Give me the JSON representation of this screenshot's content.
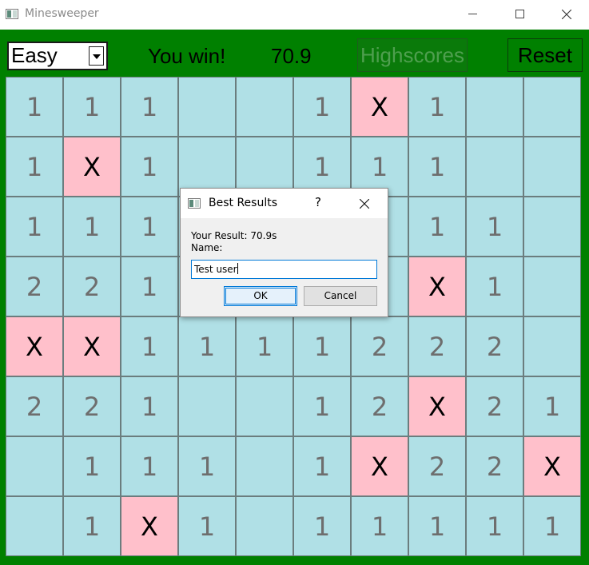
{
  "window": {
    "title": "Minesweeper"
  },
  "toolbar": {
    "difficulty": "Easy",
    "status": "You win!",
    "timer": "70.9",
    "highscores_label": "Highscores",
    "reset_label": "Reset"
  },
  "board": {
    "rows": [
      [
        {
          "t": "1"
        },
        {
          "t": "1"
        },
        {
          "t": "1"
        },
        {
          "t": ""
        },
        {
          "t": ""
        },
        {
          "t": "1"
        },
        {
          "t": "X",
          "mine": true
        },
        {
          "t": "1"
        },
        {
          "t": ""
        },
        {
          "t": ""
        }
      ],
      [
        {
          "t": "1"
        },
        {
          "t": "X",
          "mine": true
        },
        {
          "t": "1"
        },
        {
          "t": ""
        },
        {
          "t": ""
        },
        {
          "t": "1"
        },
        {
          "t": "1"
        },
        {
          "t": "1"
        },
        {
          "t": ""
        },
        {
          "t": ""
        }
      ],
      [
        {
          "t": "1"
        },
        {
          "t": "1"
        },
        {
          "t": "1"
        },
        {
          "t": ""
        },
        {
          "t": ""
        },
        {
          "t": ""
        },
        {
          "t": ""
        },
        {
          "t": "1"
        },
        {
          "t": "1"
        },
        {
          "t": ""
        }
      ],
      [
        {
          "t": "2"
        },
        {
          "t": "2"
        },
        {
          "t": "1"
        },
        {
          "t": ""
        },
        {
          "t": ""
        },
        {
          "t": ""
        },
        {
          "t": ""
        },
        {
          "t": "X",
          "mine": true
        },
        {
          "t": "1"
        },
        {
          "t": ""
        }
      ],
      [
        {
          "t": "X",
          "mine": true
        },
        {
          "t": "X",
          "mine": true
        },
        {
          "t": "1"
        },
        {
          "t": "1"
        },
        {
          "t": "1"
        },
        {
          "t": "1"
        },
        {
          "t": "2"
        },
        {
          "t": "2"
        },
        {
          "t": "2"
        },
        {
          "t": ""
        }
      ],
      [
        {
          "t": "2"
        },
        {
          "t": "2"
        },
        {
          "t": "1"
        },
        {
          "t": ""
        },
        {
          "t": ""
        },
        {
          "t": "1"
        },
        {
          "t": "2"
        },
        {
          "t": "X",
          "mine": true
        },
        {
          "t": "2"
        },
        {
          "t": "1"
        }
      ],
      [
        {
          "t": ""
        },
        {
          "t": "1"
        },
        {
          "t": "1"
        },
        {
          "t": "1"
        },
        {
          "t": ""
        },
        {
          "t": "1"
        },
        {
          "t": "X",
          "mine": true
        },
        {
          "t": "2"
        },
        {
          "t": "2"
        },
        {
          "t": "X",
          "mine": true
        }
      ],
      [
        {
          "t": ""
        },
        {
          "t": "1"
        },
        {
          "t": "X",
          "mine": true
        },
        {
          "t": "1"
        },
        {
          "t": ""
        },
        {
          "t": "1"
        },
        {
          "t": "1"
        },
        {
          "t": "1"
        },
        {
          "t": "1"
        },
        {
          "t": "1"
        }
      ]
    ]
  },
  "dialog": {
    "title": "Best Results",
    "help": "?",
    "result_line": "Your Result: 70.9s",
    "name_label": "Name:",
    "name_value": "Test user",
    "ok_label": "OK",
    "cancel_label": "Cancel"
  },
  "colors": {
    "background": "#008000",
    "cell": "#b0e0e6",
    "mine_cell": "#ffc0cb"
  }
}
